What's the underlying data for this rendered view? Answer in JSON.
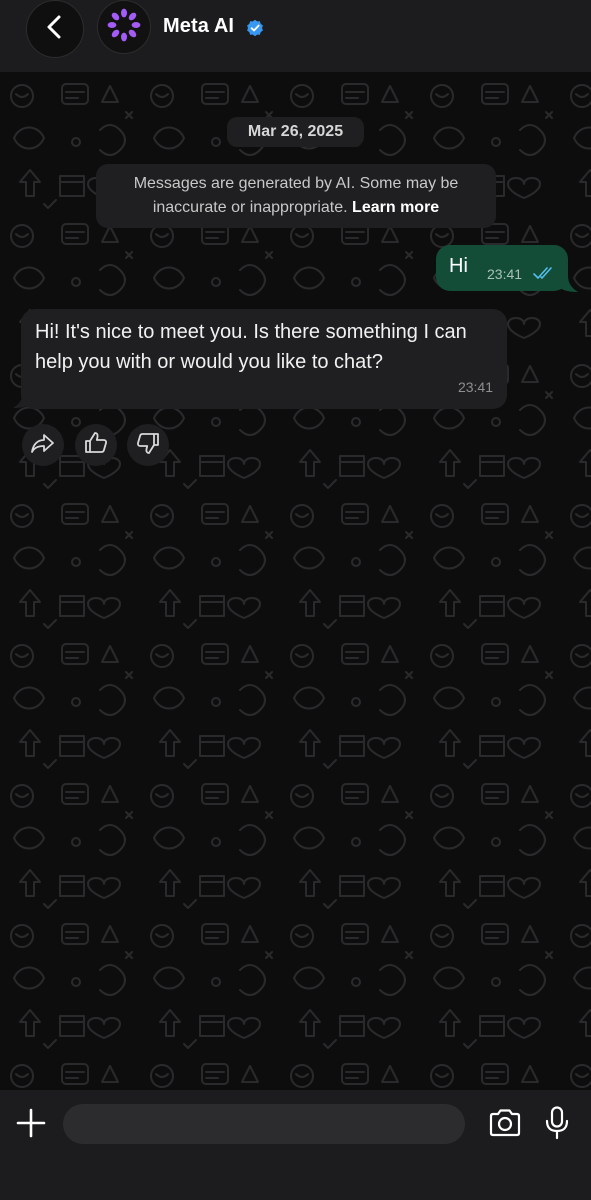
{
  "header": {
    "contact_name": "Meta AI",
    "verified": true,
    "icons": {
      "back": "chevron-left-icon",
      "avatar": "meta-ai-ring-logo",
      "verified": "verified-badge-icon"
    },
    "colors": {
      "verified_badge": "#3897f0",
      "avatar_ring": "#a35cf5"
    }
  },
  "chat": {
    "date_label": "Mar 26, 2025",
    "ai_notice": {
      "text": "Messages are generated by AI. Some may be inaccurate or inappropriate.",
      "link": "Learn more"
    },
    "messages": [
      {
        "direction": "outgoing",
        "text": "Hi",
        "time": "23:41",
        "status": "read",
        "status_icon": "double-check-icon"
      },
      {
        "direction": "incoming",
        "text": "Hi! It's nice to meet you. Is there something I can help you with or would you like to chat?",
        "time": "23:41"
      }
    ],
    "reactions": [
      {
        "icon": "share-forward-icon"
      },
      {
        "icon": "thumbs-up-icon"
      },
      {
        "icon": "thumbs-down-icon"
      }
    ],
    "colors": {
      "outgoing_bubble": "#144d37",
      "incoming_bubble": "#1f1f21",
      "read_ticks": "#53bdeb"
    }
  },
  "composer": {
    "value": "",
    "placeholder": "",
    "icons": {
      "attach": "plus-icon",
      "camera": "camera-icon",
      "mic": "microphone-icon"
    }
  }
}
